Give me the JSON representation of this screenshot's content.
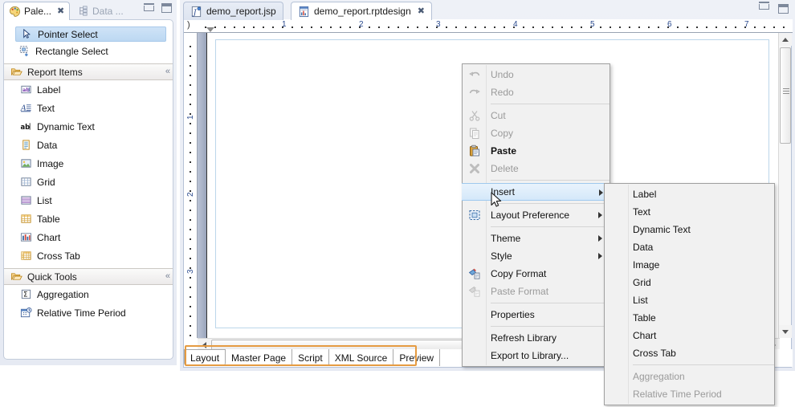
{
  "palette": {
    "tabs": [
      {
        "label": "Pale...",
        "icon": "palette-icon",
        "active": true,
        "close": "✖"
      },
      {
        "label": "Data ...",
        "icon": "data-explorer-icon",
        "active": false,
        "close": ""
      }
    ],
    "window_buttons": {
      "minimize": "minimize-icon",
      "maximize": "maximize-icon"
    },
    "tools": [
      {
        "label": "Pointer Select",
        "icon": "pointer-icon",
        "selected": true
      },
      {
        "label": "Rectangle Select",
        "icon": "rectangle-select-icon",
        "selected": false
      }
    ],
    "drawers": [
      {
        "title": "Report Items",
        "collapse_glyph": "«",
        "items": [
          {
            "label": "Label",
            "icon": "label-icon"
          },
          {
            "label": "Text",
            "icon": "text-icon"
          },
          {
            "label": "Dynamic Text",
            "icon": "dynamic-text-icon"
          },
          {
            "label": "Data",
            "icon": "data-icon"
          },
          {
            "label": "Image",
            "icon": "image-icon"
          },
          {
            "label": "Grid",
            "icon": "grid-icon"
          },
          {
            "label": "List",
            "icon": "list-icon"
          },
          {
            "label": "Table",
            "icon": "table-icon"
          },
          {
            "label": "Chart",
            "icon": "chart-icon"
          },
          {
            "label": "Cross Tab",
            "icon": "cross-tab-icon"
          }
        ]
      },
      {
        "title": "Quick Tools",
        "collapse_glyph": "«",
        "items": [
          {
            "label": "Aggregation",
            "icon": "aggregation-icon"
          },
          {
            "label": "Relative Time Period",
            "icon": "relative-time-period-icon"
          }
        ]
      }
    ]
  },
  "editor": {
    "tabs": [
      {
        "label": "demo_report.jsp",
        "icon": "jsp-file-icon",
        "active": false
      },
      {
        "label": "demo_report.rptdesign",
        "icon": "rptdesign-file-icon",
        "active": true,
        "close": "✖"
      }
    ],
    "window_buttons": {
      "minimize": "minimize-icon",
      "maximize": "maximize-icon"
    },
    "ruler": {
      "horizontal_labels": [
        "1",
        "2",
        "3",
        "4",
        "5",
        "6",
        "7"
      ],
      "vertical_labels": [
        "1",
        "2",
        "3"
      ],
      "origin_glyph": ")"
    },
    "bottom_tabs": [
      {
        "label": "Layout",
        "active": true
      },
      {
        "label": "Master Page",
        "active": false
      },
      {
        "label": "Script",
        "active": false
      },
      {
        "label": "XML Source",
        "active": false
      },
      {
        "label": "Preview",
        "active": false
      }
    ],
    "highlight_color": "#e59b42"
  },
  "context_menu": {
    "groups": [
      [
        {
          "label": "Undo",
          "icon": "undo-icon",
          "disabled": true,
          "submenu": false,
          "bold": false
        },
        {
          "label": "Redo",
          "icon": "redo-icon",
          "disabled": true,
          "submenu": false,
          "bold": false
        }
      ],
      [
        {
          "label": "Cut",
          "icon": "cut-icon",
          "disabled": true,
          "submenu": false,
          "bold": false
        },
        {
          "label": "Copy",
          "icon": "copy-icon",
          "disabled": true,
          "submenu": false,
          "bold": false
        },
        {
          "label": "Paste",
          "icon": "paste-icon",
          "disabled": false,
          "submenu": false,
          "bold": true
        },
        {
          "label": "Delete",
          "icon": "delete-icon",
          "disabled": true,
          "submenu": false,
          "bold": false
        }
      ],
      [
        {
          "label": "Insert",
          "icon": "",
          "disabled": false,
          "submenu": true,
          "bold": false,
          "highlighted": true
        }
      ],
      [
        {
          "label": "Layout Preference",
          "icon": "layout-preference-icon",
          "disabled": false,
          "submenu": true,
          "bold": false
        }
      ],
      [
        {
          "label": "Theme",
          "icon": "",
          "disabled": false,
          "submenu": true,
          "bold": false
        },
        {
          "label": "Style",
          "icon": "",
          "disabled": false,
          "submenu": true,
          "bold": false
        },
        {
          "label": "Copy Format",
          "icon": "copy-format-icon",
          "disabled": false,
          "submenu": false,
          "bold": false
        },
        {
          "label": "Paste Format",
          "icon": "paste-format-icon",
          "disabled": true,
          "submenu": false,
          "bold": false
        }
      ],
      [
        {
          "label": "Properties",
          "icon": "",
          "disabled": false,
          "submenu": false,
          "bold": false
        }
      ],
      [
        {
          "label": "Refresh Library",
          "icon": "",
          "disabled": false,
          "submenu": false,
          "bold": false
        },
        {
          "label": "Export to Library...",
          "icon": "",
          "disabled": false,
          "submenu": false,
          "bold": false
        }
      ]
    ]
  },
  "insert_submenu": {
    "groups": [
      [
        {
          "label": "Label",
          "disabled": false
        },
        {
          "label": "Text",
          "disabled": false
        },
        {
          "label": "Dynamic Text",
          "disabled": false
        },
        {
          "label": "Data",
          "disabled": false
        },
        {
          "label": "Image",
          "disabled": false
        },
        {
          "label": "Grid",
          "disabled": false
        },
        {
          "label": "List",
          "disabled": false
        },
        {
          "label": "Table",
          "disabled": false
        },
        {
          "label": "Chart",
          "disabled": false
        },
        {
          "label": "Cross Tab",
          "disabled": false
        }
      ],
      [
        {
          "label": "Aggregation",
          "disabled": true
        },
        {
          "label": "Relative Time Period",
          "disabled": true
        }
      ]
    ]
  }
}
